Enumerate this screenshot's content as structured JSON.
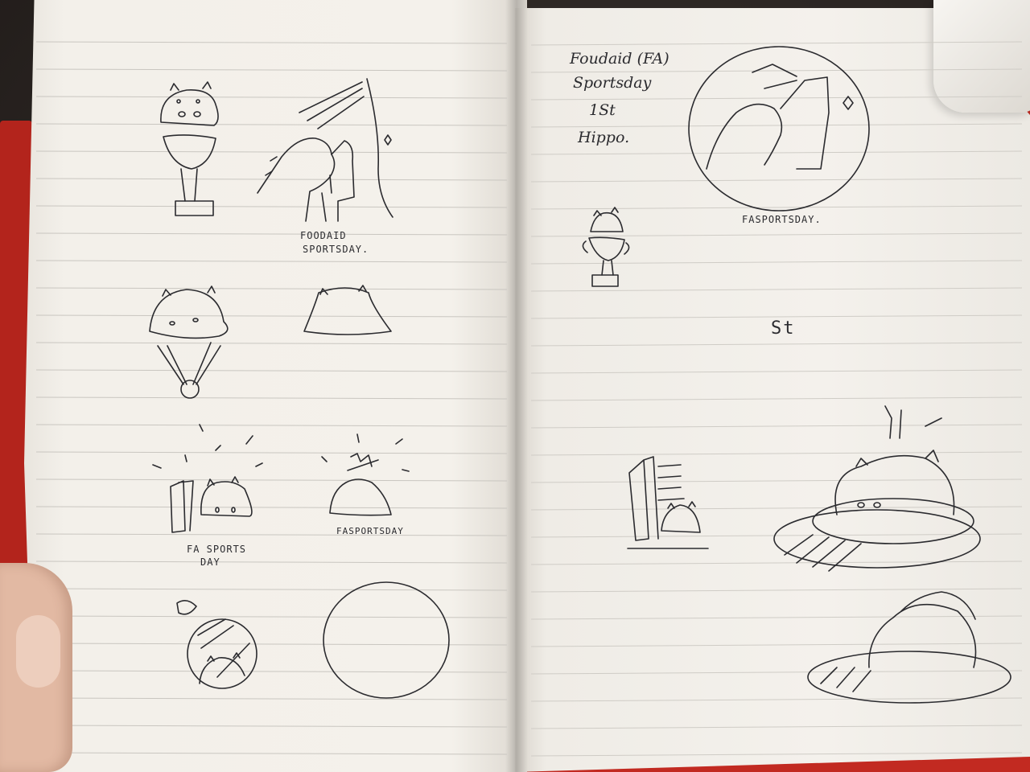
{
  "photo": {
    "subject": "notebook-sketches"
  },
  "left_page": {
    "labels": {
      "foodaid_sportsday": [
        "FOODAID",
        "SPORTSDAY."
      ],
      "fa_sports_day": [
        "FA SPORTS",
        "DAY"
      ],
      "fa_sportsday_small": "FASPORTSDAY"
    }
  },
  "right_page": {
    "notes": [
      "Foudaid (FA)",
      "Sportsday",
      "1St",
      "Hippo."
    ],
    "fa_sportsday": "FASPORTSDAY.",
    "st_mark": "St"
  },
  "colors": {
    "paper": "#f4f1eb",
    "ink": "#2b2b2f",
    "rule_line": "#c9c6c0",
    "cover": "#c22a21"
  }
}
